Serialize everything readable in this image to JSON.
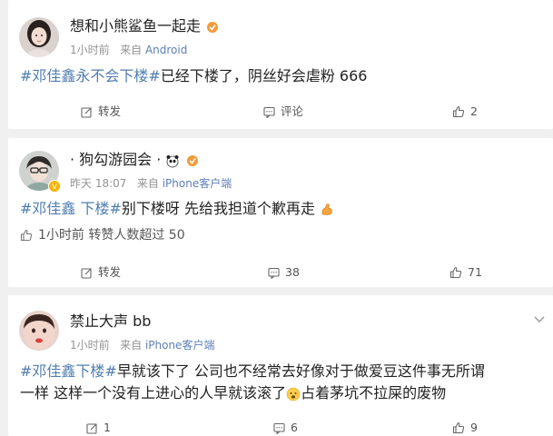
{
  "posts": [
    {
      "username": "想和小熊鲨鱼一起走",
      "time": "1小时前",
      "source_prefix": "来自",
      "source": "Android",
      "text_topic": "#邓佳鑫永不会下楼#",
      "text_rest": "已经下楼了，阴丝好会虐粉 666",
      "actions": {
        "repost": "转发",
        "comment": "评论",
        "like": "2"
      }
    },
    {
      "username": "· 狗勾游园会 ·",
      "time": "昨天 18:07",
      "source_prefix": "来自",
      "source": "iPhone客户端",
      "text_topic": "#邓佳鑫 下楼#",
      "text_rest": "别下楼呀 先给我担道个歉再走",
      "subinfo": "1小时前 转赞人数超过 50",
      "actions": {
        "repost": "转发",
        "comment": "38",
        "like": "71"
      }
    },
    {
      "username": "禁止大声 bb",
      "time": "1小时前",
      "source_prefix": "来自",
      "source": "iPhone客户端",
      "text_topic": "#邓佳鑫下楼#",
      "text_rest1": "早就该下了 公司也不经常去好像对于做爱豆这件事无所谓",
      "text_rest2a": "一样 这样一个没有上进心的人早就该滚了",
      "text_rest2b": "占着茅坑不拉屎的废物",
      "actions": {
        "repost": "1",
        "comment": "6",
        "like": "9"
      }
    }
  ],
  "icons": {
    "repost": "share-icon",
    "comment": "comment-icon",
    "like": "thumbs-up-icon",
    "menu": "chevron-down-icon"
  },
  "colors": {
    "topic": "#507daf",
    "source": "#5d7fb8",
    "meta": "#939393",
    "background": "#f0f0f0"
  }
}
